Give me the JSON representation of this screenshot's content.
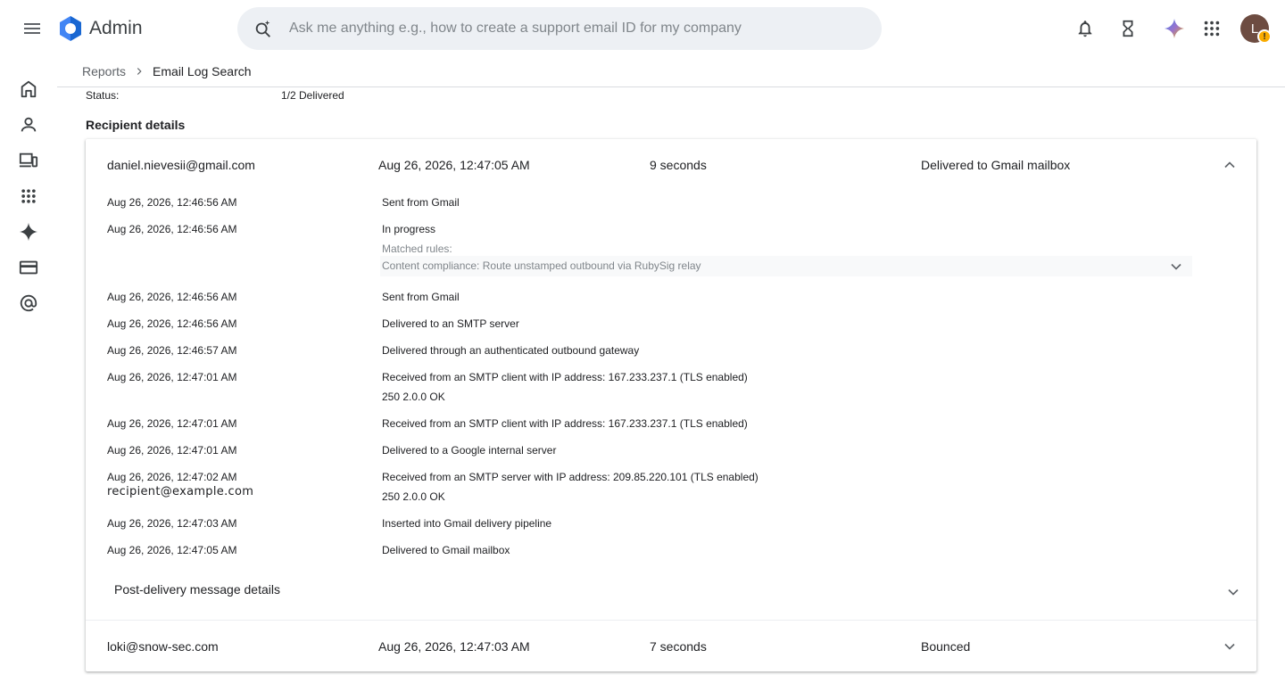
{
  "app": {
    "title": "Admin"
  },
  "search": {
    "placeholder": "Ask me anything e.g., how to create a support email ID for my company"
  },
  "user": {
    "avatar_initial": "L",
    "badge": "!"
  },
  "breadcrumb": {
    "parent": "Reports",
    "current": "Email Log Search"
  },
  "status": {
    "label": "Status:",
    "value": "1/2 Delivered"
  },
  "section": {
    "title": "Recipient details"
  },
  "recipients": [
    {
      "email": "daniel.nievesii@gmail.com",
      "time": "Aug 26, 2026, 12:47:05 AM",
      "duration": "9 seconds",
      "result": "Delivered to Gmail mailbox",
      "expanded": true
    },
    {
      "email": "loki@snow-sec.com",
      "time": "Aug 26, 2026, 12:47:03 AM",
      "duration": "7 seconds",
      "result": "Bounced",
      "expanded": false
    }
  ],
  "events": [
    {
      "time": "Aug 26, 2026, 12:46:56 AM",
      "desc": "Sent from Gmail"
    },
    {
      "time": "Aug 26, 2026, 12:46:56 AM",
      "desc": "In progress"
    },
    {
      "time": "Aug 26, 2026, 12:46:56 AM",
      "desc": "Sent from Gmail"
    },
    {
      "time": "Aug 26, 2026, 12:46:56 AM",
      "desc": "Delivered to an SMTP server"
    },
    {
      "time": "Aug 26, 2026, 12:46:57 AM",
      "desc": "Delivered through an authenticated outbound gateway"
    },
    {
      "time": "Aug 26, 2026, 12:47:01 AM",
      "desc": "Received from an SMTP client with IP address: 167.233.237.1 (TLS enabled)",
      "sub": "250 2.0.0 OK"
    },
    {
      "time": "Aug 26, 2026, 12:47:01 AM",
      "desc": "Received from an SMTP client with IP address: 167.233.237.1 (TLS enabled)"
    },
    {
      "time": "Aug 26, 2026, 12:47:01 AM",
      "desc": "Delivered to a Google internal server"
    },
    {
      "time": "Aug 26, 2026, 12:47:02 AM",
      "desc": "Received from an SMTP server with IP address: 209.85.220.101 (TLS enabled)",
      "sub": "250 2.0.0 OK"
    },
    {
      "time": "Aug 26, 2026, 12:47:03 AM",
      "desc": "Inserted into Gmail delivery pipeline"
    },
    {
      "time": "Aug 26, 2026, 12:47:05 AM",
      "desc": "Delivered to Gmail mailbox"
    }
  ],
  "matched_rules": {
    "label": "Matched rules:",
    "rule": "Content compliance: Route unstamped outbound via RubySig relay"
  },
  "overlay_email": "recipient@example.com",
  "post_delivery": {
    "label": "Post-delivery message details"
  },
  "colors": {
    "accent": "#1a73e8",
    "avatar_bg": "#6d4c41",
    "badge": "#f9ab00",
    "search_bg": "#edf0f4"
  }
}
